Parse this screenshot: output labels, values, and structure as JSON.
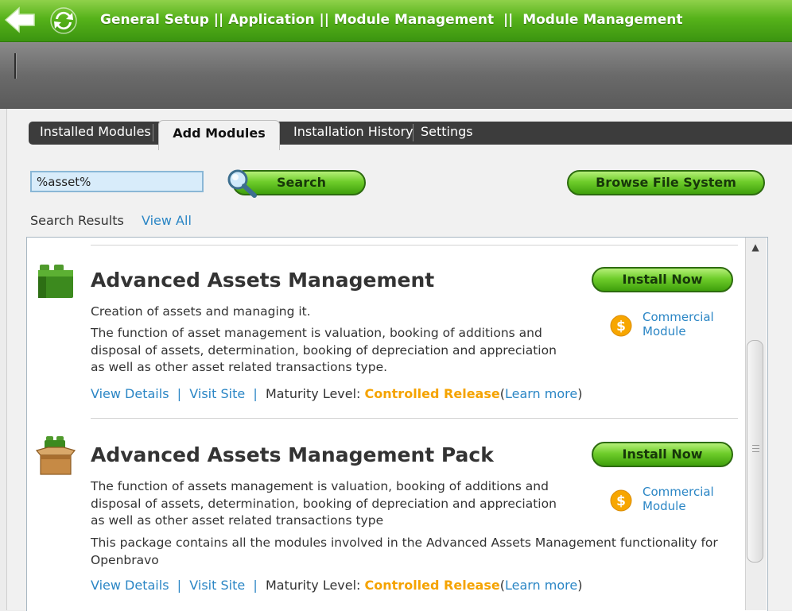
{
  "header": {
    "breadcrumb": "General Setup || Application || Module Management  ||  Module Management"
  },
  "tabs": {
    "installed": "Installed Modules",
    "add": "Add Modules",
    "history": "Installation History",
    "settings": "Settings"
  },
  "search": {
    "value": "%asset%",
    "button": "Search",
    "browse": "Browse File System",
    "results_label": "Search Results",
    "view_all": "View All"
  },
  "modules": [
    {
      "title": "Advanced Assets Management",
      "description": "Creation of assets and managing it.",
      "help": "The function of asset management is valuation, booking of additions and disposal of assets, determination, booking of depreciation and appreciation as well as other asset related transactions type.",
      "install": "Install Now",
      "license": "Commercial Module",
      "view_details": "View Details",
      "visit_site": "Visit Site",
      "maturity_label": "Maturity Level:",
      "maturity_value": "Controlled Release",
      "learn_more": "Learn more",
      "icon": "module-icon"
    },
    {
      "title": "Advanced Assets Management Pack",
      "description": "The function of assets management is valuation, booking of additions and disposal of assets, determination, booking of depreciation and appreciation as well as other asset related transactions type",
      "help": "This package contains all the modules involved in the Advanced Assets Management functionality for Openbravo",
      "install": "Install Now",
      "license": "Commercial Module",
      "view_details": "View Details",
      "visit_site": "Visit Site",
      "maturity_label": "Maturity Level:",
      "maturity_value": "Controlled Release",
      "learn_more": "Learn more",
      "icon": "pack-icon"
    }
  ],
  "colors": {
    "brand_green": "#56b21a",
    "link_blue": "#2b86c5",
    "release_orange": "#f5a300"
  }
}
